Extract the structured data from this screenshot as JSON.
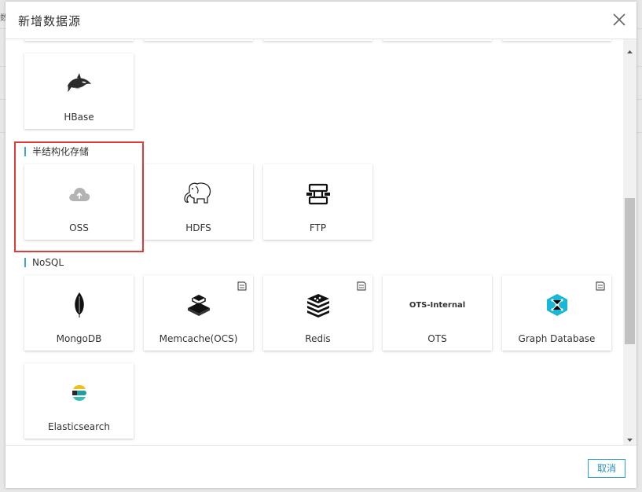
{
  "dialog": {
    "title": "新增数据源",
    "cancel_label": "取消"
  },
  "backdrop": {
    "edge_char": "数"
  },
  "sections": {
    "semi_structured": "半结构化存储",
    "nosql": "NoSQL"
  },
  "cards": {
    "hbase": {
      "label": "HBase",
      "icon": "orca-icon"
    },
    "oss": {
      "label": "OSS",
      "icon": "cloud-upload-icon"
    },
    "hdfs": {
      "label": "HDFS",
      "icon": "elephant-icon"
    },
    "ftp": {
      "label": "FTP",
      "icon": "network-transfer-icon"
    },
    "mongodb": {
      "label": "MongoDB",
      "icon": "leaf-icon"
    },
    "memcache": {
      "label": "Memcache(OCS)",
      "icon": "cube-stack-icon",
      "badge": "document-badge-icon"
    },
    "redis": {
      "label": "Redis",
      "icon": "stacked-boxes-icon",
      "badge": "document-badge-icon"
    },
    "ots": {
      "label": "OTS",
      "logo_text": "OTS-Internal"
    },
    "graph": {
      "label": "Graph Database",
      "icon": "graph-hex-icon",
      "badge": "document-badge-icon"
    },
    "elasticsearch": {
      "label": "Elasticsearch",
      "icon": "elasticsearch-logo-icon"
    }
  },
  "colors": {
    "section_accent": "#3fa4d8",
    "highlight_border": "#e03b3b",
    "cancel_border": "#2aa4c9",
    "graph_icon": "#19b7d6"
  }
}
